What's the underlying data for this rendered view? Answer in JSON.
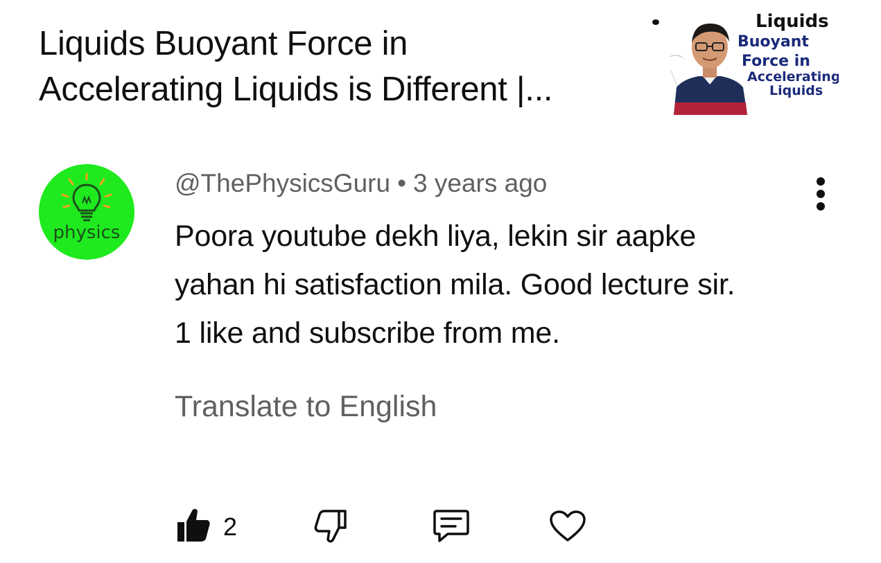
{
  "video": {
    "title_line1": "Liquids Buoyant Force in",
    "title_line2": "Accelerating Liquids is Different |...",
    "thumbnail": {
      "text_line1": "Liquids",
      "text_line2": "Buoyant",
      "text_line3": "Force in",
      "text_line4": "Accelerating",
      "text_line5": "Liquids"
    }
  },
  "comment": {
    "avatar_text": "physics",
    "author": "@ThePhysicsGuru",
    "separator": "•",
    "time": "3 years ago",
    "text_line1": "Poora youtube dekh liya, lekin sir aapke",
    "text_line2": "yahan hi satisfaction mila. Good lecture sir.",
    "text_line3": "1 like and subscribe from me.",
    "translate_label": "Translate to English",
    "like_count": "2"
  },
  "icons": {
    "like": "thumbs-up-icon",
    "dislike": "thumbs-down-icon",
    "reply": "comment-icon",
    "heart": "heart-icon",
    "menu": "more-vert-icon"
  },
  "colors": {
    "avatar_bg": "#1eea1e",
    "secondary_text": "#606060",
    "primary_text": "#0f0f0f"
  }
}
